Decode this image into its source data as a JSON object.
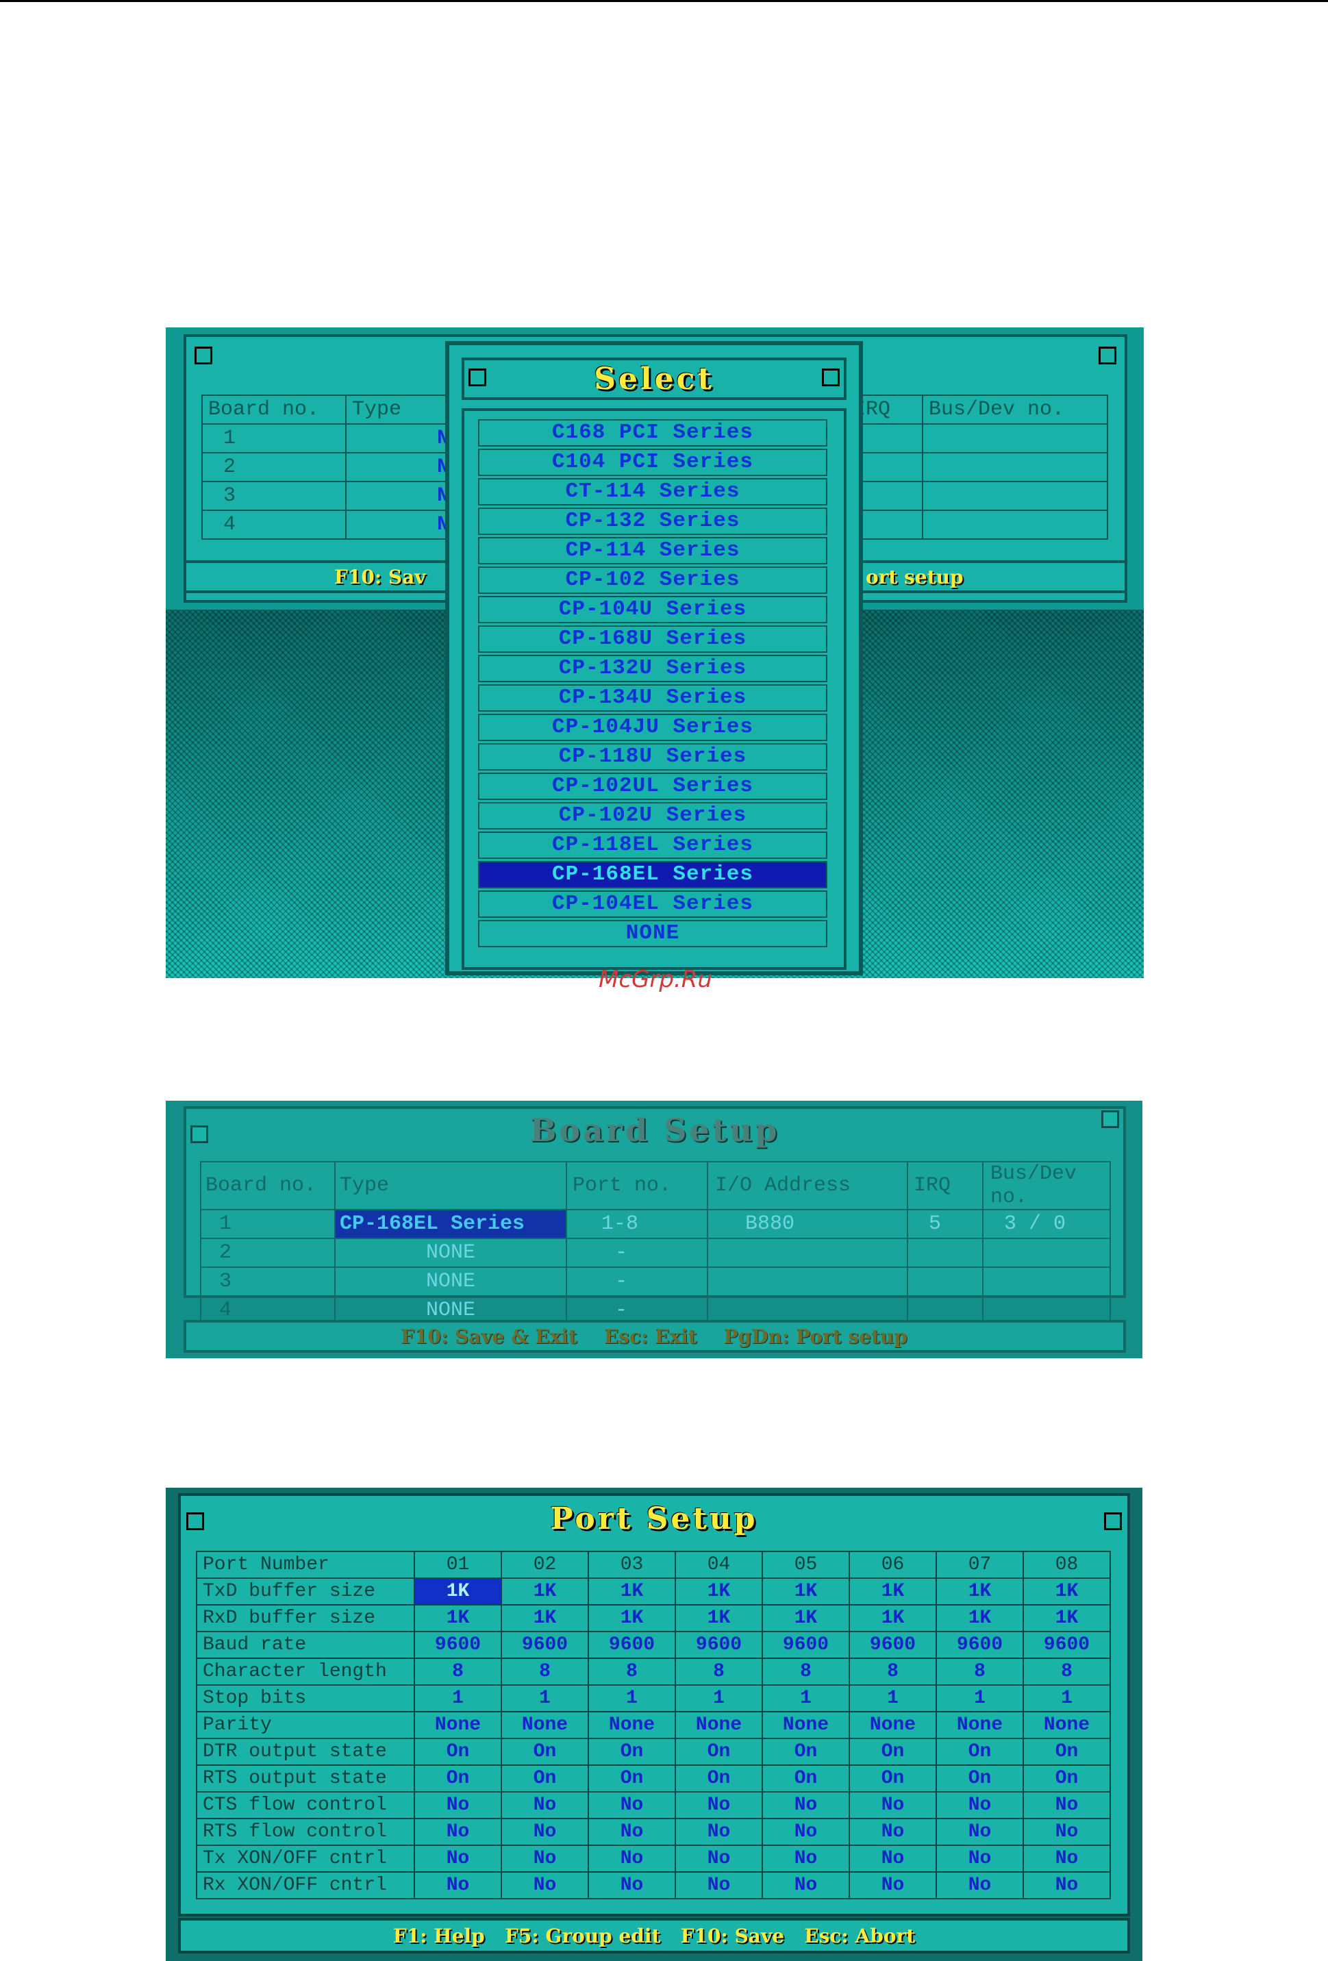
{
  "watermark": "McGrp.Ru",
  "select_screen": {
    "title": "Select",
    "board_table_fragments": {
      "headers": [
        "Board no.",
        "Type",
        "IRQ",
        "Bus/Dev no."
      ],
      "rows": [
        {
          "board": "1",
          "type": "NO"
        },
        {
          "board": "2",
          "type": "NO"
        },
        {
          "board": "3",
          "type": "NO"
        },
        {
          "board": "4",
          "type": "NO"
        }
      ],
      "footer_left": "F10: Sav",
      "footer_right": "ort setup"
    },
    "options": [
      "C168 PCI Series",
      "C104 PCI Series",
      "CT-114 Series",
      "CP-132 Series",
      "CP-114 Series",
      "CP-102 Series",
      "CP-104U Series",
      "CP-168U Series",
      "CP-132U Series",
      "CP-134U Series",
      "CP-104JU Series",
      "CP-118U Series",
      "CP-102UL Series",
      "CP-102U Series",
      "CP-118EL Series",
      "CP-168EL Series",
      "CP-104EL Series",
      "NONE"
    ],
    "selected_option": "CP-168EL Series"
  },
  "board_setup": {
    "title": "Board Setup",
    "headers": [
      "Board no.",
      "Type",
      "Port no.",
      "I/O Address",
      "IRQ",
      "Bus/Dev no."
    ],
    "rows": [
      [
        "1",
        "CP-168EL Series",
        "1-8",
        "B880",
        "5",
        "3 / 0"
      ],
      [
        "2",
        "NONE",
        "-",
        "",
        "",
        ""
      ],
      [
        "3",
        "NONE",
        "-",
        "",
        "",
        ""
      ],
      [
        "4",
        "NONE",
        "-",
        "",
        "",
        ""
      ]
    ],
    "footer": "F10: Save & Exit    Esc: Exit    PgDn: Port setup"
  },
  "port_setup": {
    "title": "Port Setup",
    "header_label": "Port Number",
    "ports": [
      "01",
      "02",
      "03",
      "04",
      "05",
      "06",
      "07",
      "08"
    ],
    "rows": [
      {
        "label": "TxD buffer size",
        "values": [
          "1K",
          "1K",
          "1K",
          "1K",
          "1K",
          "1K",
          "1K",
          "1K"
        ]
      },
      {
        "label": "RxD buffer size",
        "values": [
          "1K",
          "1K",
          "1K",
          "1K",
          "1K",
          "1K",
          "1K",
          "1K"
        ]
      },
      {
        "label": "Baud rate",
        "values": [
          "9600",
          "9600",
          "9600",
          "9600",
          "9600",
          "9600",
          "9600",
          "9600"
        ]
      },
      {
        "label": "Character length",
        "values": [
          "8",
          "8",
          "8",
          "8",
          "8",
          "8",
          "8",
          "8"
        ]
      },
      {
        "label": "Stop bits",
        "values": [
          "1",
          "1",
          "1",
          "1",
          "1",
          "1",
          "1",
          "1"
        ]
      },
      {
        "label": "Parity",
        "values": [
          "None",
          "None",
          "None",
          "None",
          "None",
          "None",
          "None",
          "None"
        ]
      },
      {
        "label": "DTR output state",
        "values": [
          "On",
          "On",
          "On",
          "On",
          "On",
          "On",
          "On",
          "On"
        ]
      },
      {
        "label": "RTS output state",
        "values": [
          "On",
          "On",
          "On",
          "On",
          "On",
          "On",
          "On",
          "On"
        ]
      },
      {
        "label": "CTS flow control",
        "values": [
          "No",
          "No",
          "No",
          "No",
          "No",
          "No",
          "No",
          "No"
        ]
      },
      {
        "label": "RTS flow control",
        "values": [
          "No",
          "No",
          "No",
          "No",
          "No",
          "No",
          "No",
          "No"
        ]
      },
      {
        "label": "Tx XON/OFF cntrl",
        "values": [
          "No",
          "No",
          "No",
          "No",
          "No",
          "No",
          "No",
          "No"
        ]
      },
      {
        "label": "Rx XON/OFF cntrl",
        "values": [
          "No",
          "No",
          "No",
          "No",
          "No",
          "No",
          "No",
          "No"
        ]
      }
    ],
    "footer": "F1: Help   F5: Group edit   F10: Save   Esc: Abort"
  },
  "colors": {
    "teal": "#1ab3a8",
    "title_yellow": "#ffeb3b",
    "option_blue": "#1030d8",
    "selection_bg": "#1019b0",
    "watermark_red": "#d23a3a"
  }
}
